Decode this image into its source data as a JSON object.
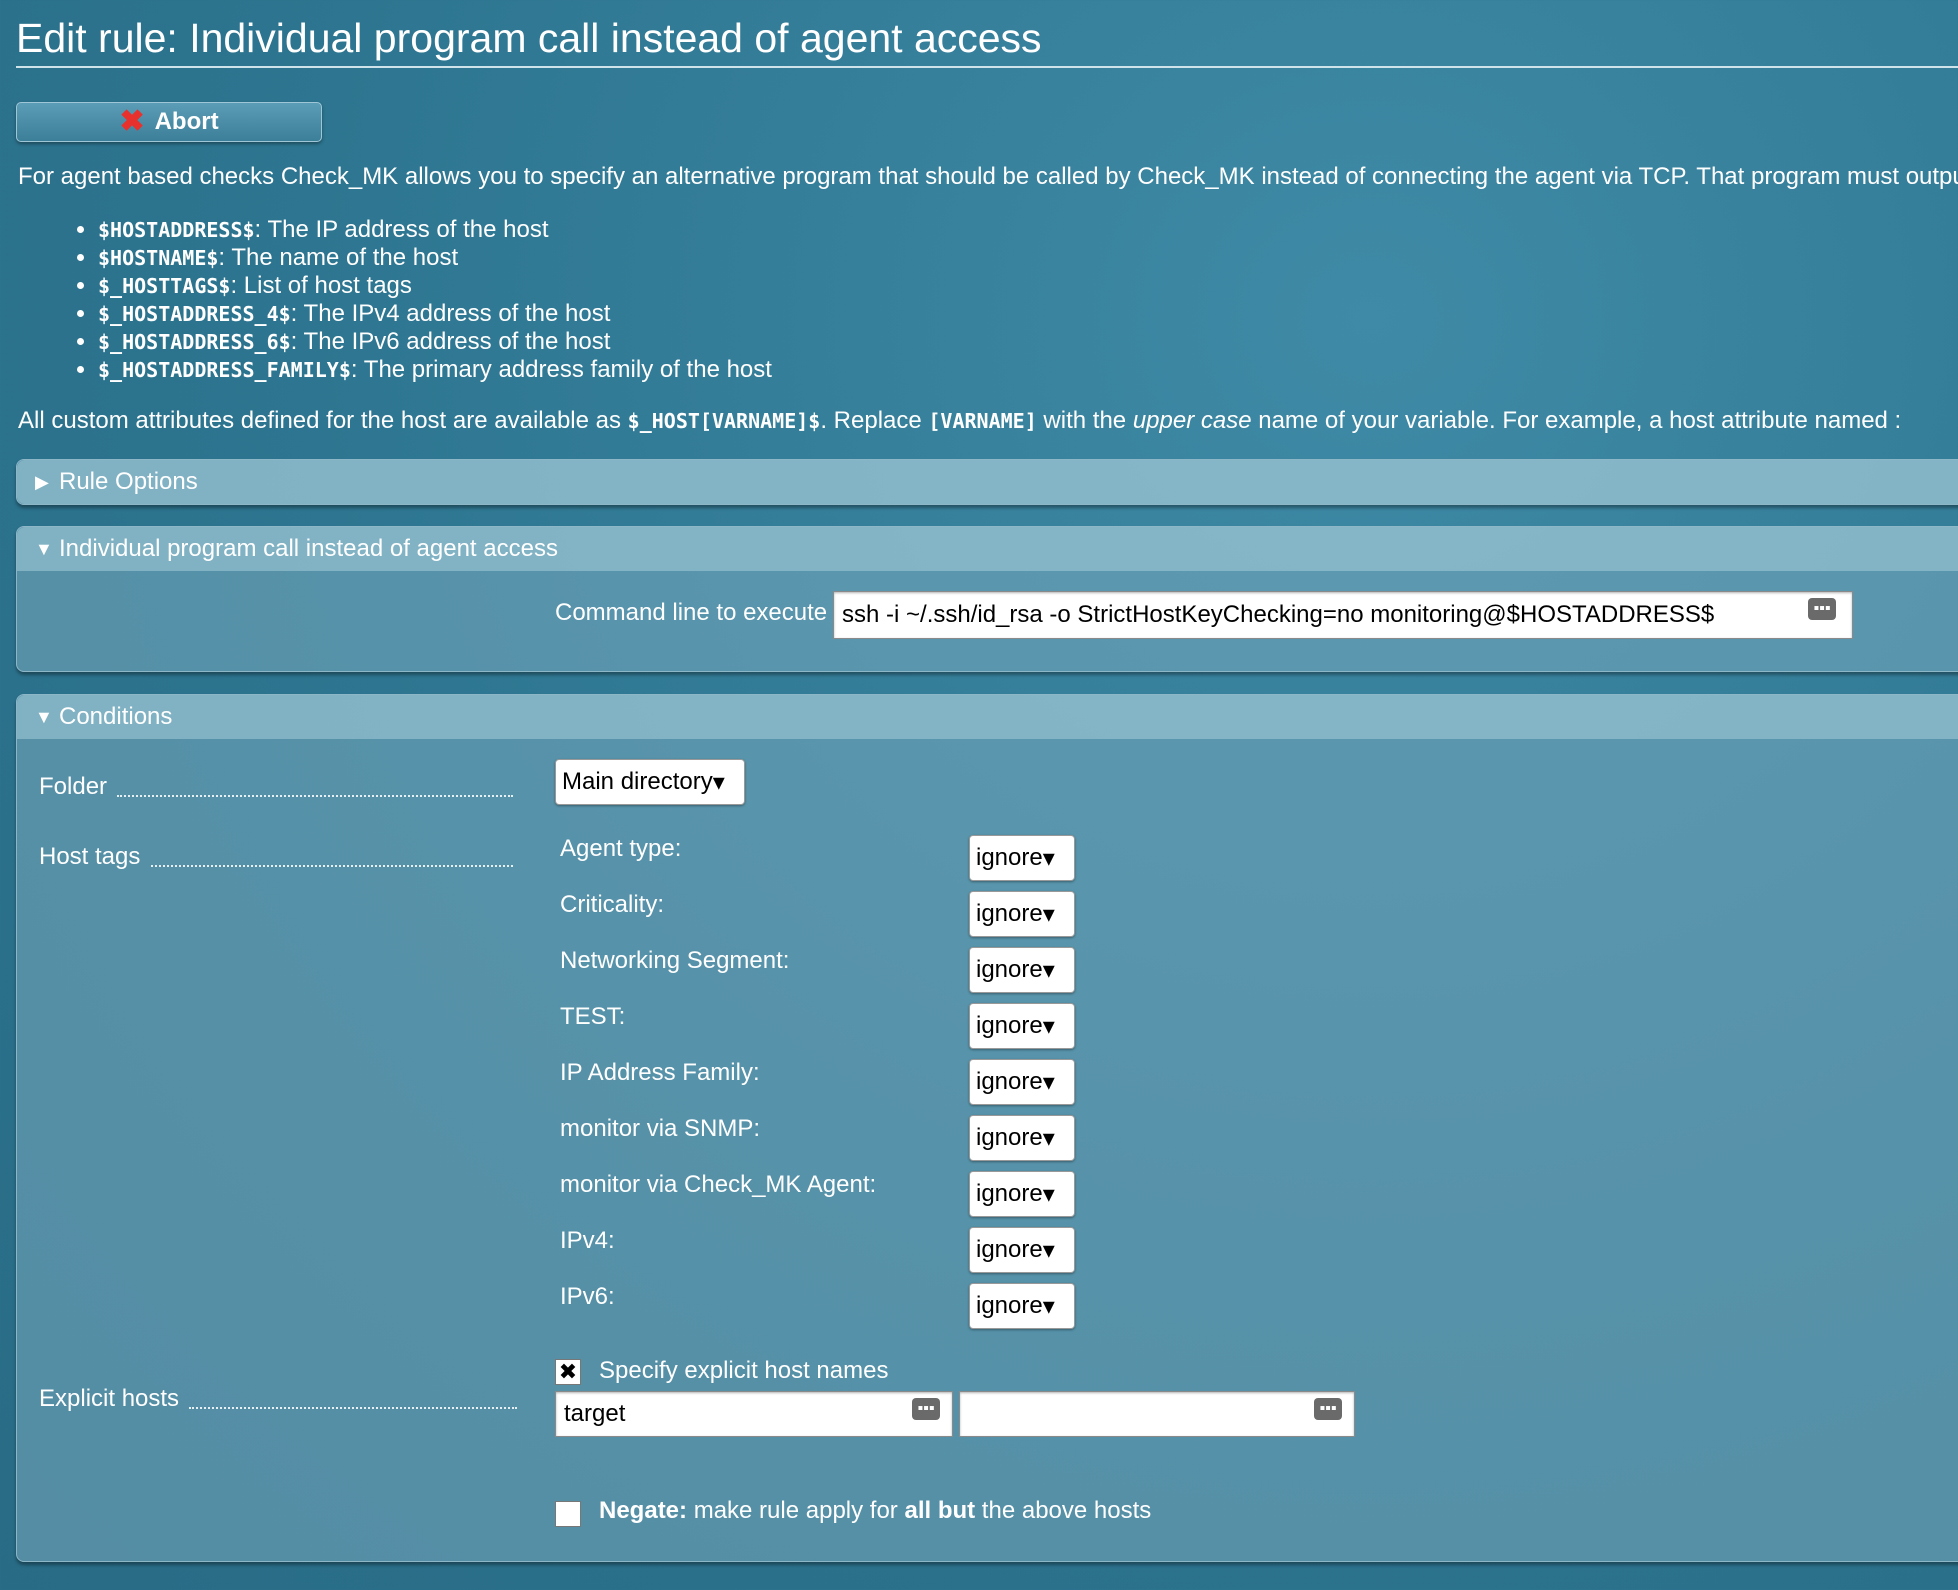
{
  "page": {
    "title": "Edit rule: Individual program call instead of agent access",
    "abort_label": "Abort",
    "intro": "For agent based checks Check_MK allows you to specify an alternative program that should be called by Check_MK instead of connecting the agent via TCP. That program must outpu",
    "macros": [
      {
        "name": "$HOSTADDRESS$",
        "desc": ": The IP address of the host"
      },
      {
        "name": "$HOSTNAME$",
        "desc": ": The name of the host"
      },
      {
        "name": "$_HOSTTAGS$",
        "desc": ": List of host tags"
      },
      {
        "name": "$_HOSTADDRESS_4$",
        "desc": ": The IPv4 address of the host"
      },
      {
        "name": "$_HOSTADDRESS_6$",
        "desc": ": The IPv6 address of the host"
      },
      {
        "name": "$_HOSTADDRESS_FAMILY$",
        "desc": ": The primary address family of the host"
      }
    ],
    "custom": {
      "part1": "All custom attributes defined for the host are available as ",
      "code1": "$_HOST[VARNAME]$",
      "part2": ". Replace ",
      "code2": "[VARNAME]",
      "part3": " with the ",
      "italic": "upper case",
      "part4": " name of your variable. For example, a host attribute named :"
    }
  },
  "sections": {
    "rule_options": "Rule Options",
    "program": {
      "header": "Individual program call instead of agent access",
      "command_label": "Command line to execute",
      "command_value": "ssh -i ~/.ssh/id_rsa -o StrictHostKeyChecking=no monitoring@$HOSTADDRESS$"
    },
    "conditions": {
      "header": "Conditions",
      "folder_label": "Folder",
      "folder_value": "Main directory",
      "host_tags_label": "Host tags",
      "tags": [
        {
          "label": "Agent type:",
          "value": "ignore"
        },
        {
          "label": "Criticality:",
          "value": "ignore"
        },
        {
          "label": "Networking Segment:",
          "value": "ignore"
        },
        {
          "label": "TEST:",
          "value": "ignore"
        },
        {
          "label": "IP Address Family:",
          "value": "ignore"
        },
        {
          "label": "monitor via SNMP:",
          "value": "ignore"
        },
        {
          "label": "monitor via Check_MK Agent:",
          "value": "ignore"
        },
        {
          "label": "IPv4:",
          "value": "ignore"
        },
        {
          "label": "IPv6:",
          "value": "ignore"
        }
      ],
      "explicit_hosts_label": "Explicit hosts",
      "specify_label": "Specify explicit host names",
      "host_values": [
        "target",
        ""
      ],
      "negate_bold": "Negate:",
      "negate_part1": " make rule apply for ",
      "negate_bold2": "all but",
      "negate_part2": " the above hosts"
    }
  },
  "icons": {
    "abort": "close-x-icon",
    "collapsed": "triangle-right-icon",
    "expanded": "triangle-down-icon",
    "keyboard": "keyboard-icon",
    "dropdown": "dropdown-arrow-icon"
  },
  "colors": {
    "background": "#2d7590",
    "abort_x": "#e8312c"
  }
}
